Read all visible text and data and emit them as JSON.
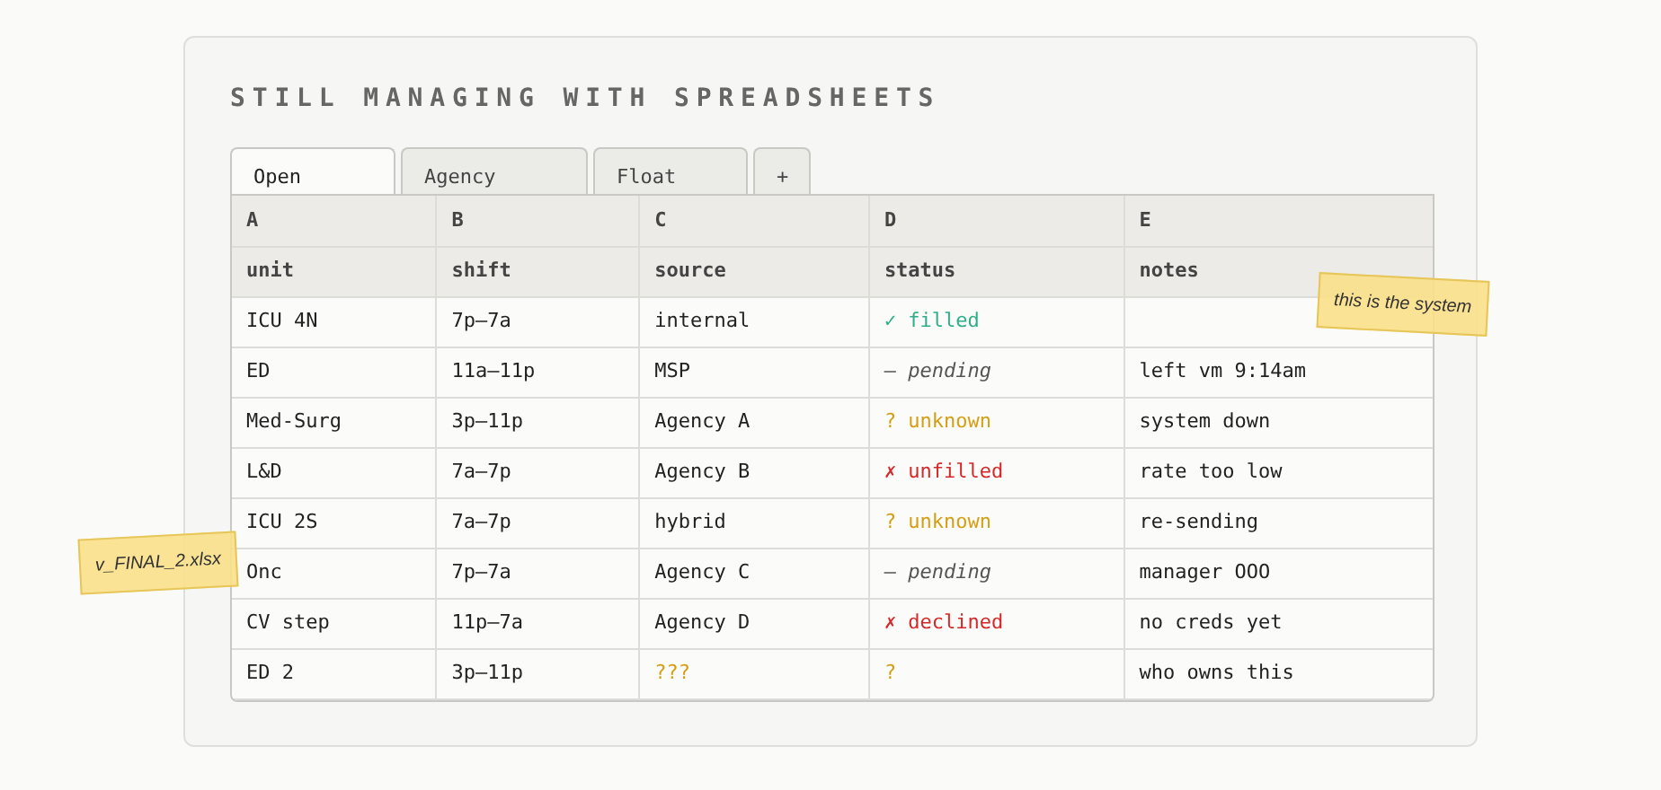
{
  "title": "STILL MANAGING WITH SPREADSHEETS",
  "tabs": [
    {
      "label": "Open",
      "selected": true
    },
    {
      "label": "Agency",
      "selected": false
    },
    {
      "label": "Float",
      "selected": false
    },
    {
      "label": "+",
      "selected": false
    }
  ],
  "table": {
    "column_letters": [
      "A",
      "B",
      "C",
      "D",
      "E"
    ],
    "columns": [
      "unit",
      "shift",
      "source",
      "status",
      "notes"
    ],
    "rows": [
      {
        "unit": "ICU 4N",
        "shift": "7p–7a",
        "source": {
          "kind": "known",
          "text": "internal"
        },
        "status": {
          "kind": "filled",
          "symbol": "✓",
          "label": "filled"
        }
      },
      {
        "unit": "ED",
        "shift": "11a–11p",
        "source": {
          "kind": "known",
          "text": "MSP"
        },
        "status": {
          "kind": "pending",
          "symbol": "—",
          "label": "pending"
        },
        "notes": "left vm 9:14am"
      },
      {
        "unit": "Med-Surg",
        "shift": "3p–11p",
        "source": {
          "kind": "known",
          "text": "Agency A"
        },
        "status": {
          "kind": "unknown",
          "symbol": "?",
          "label": "unknown"
        },
        "notes": "system down"
      },
      {
        "unit": "L&D",
        "shift": "7a–7p",
        "source": {
          "kind": "known",
          "text": "Agency B"
        },
        "status": {
          "kind": "failed",
          "symbol": "✗",
          "label": "unfilled"
        },
        "notes": "rate too low"
      },
      {
        "unit": "ICU 2S",
        "shift": "7a–7p",
        "source": {
          "kind": "known",
          "text": "hybrid"
        },
        "status": {
          "kind": "unknown",
          "symbol": "?",
          "label": "unknown"
        },
        "notes": "re-sending"
      },
      {
        "unit": "Onc",
        "shift": "7p–7a",
        "source": {
          "kind": "known",
          "text": "Agency C"
        },
        "status": {
          "kind": "pending",
          "symbol": "—",
          "label": "pending"
        },
        "notes": "manager OOO"
      },
      {
        "unit": "CV step",
        "shift": "11p–7a",
        "source": {
          "kind": "known",
          "text": "Agency D"
        },
        "status": {
          "kind": "failed",
          "symbol": "✗",
          "label": "declined"
        },
        "notes": "no creds yet"
      },
      {
        "unit": "ED 2",
        "shift": "3p–11p",
        "source": {
          "kind": "unknown",
          "text": "???"
        },
        "status": {
          "kind": "unknown",
          "symbol": "?"
        },
        "notes": "who owns this"
      }
    ]
  },
  "sticky_notes": [
    {
      "kind": "right",
      "text": "this is the system"
    },
    {
      "kind": "left",
      "text": "v_FINAL_2.xlsx"
    }
  ]
}
